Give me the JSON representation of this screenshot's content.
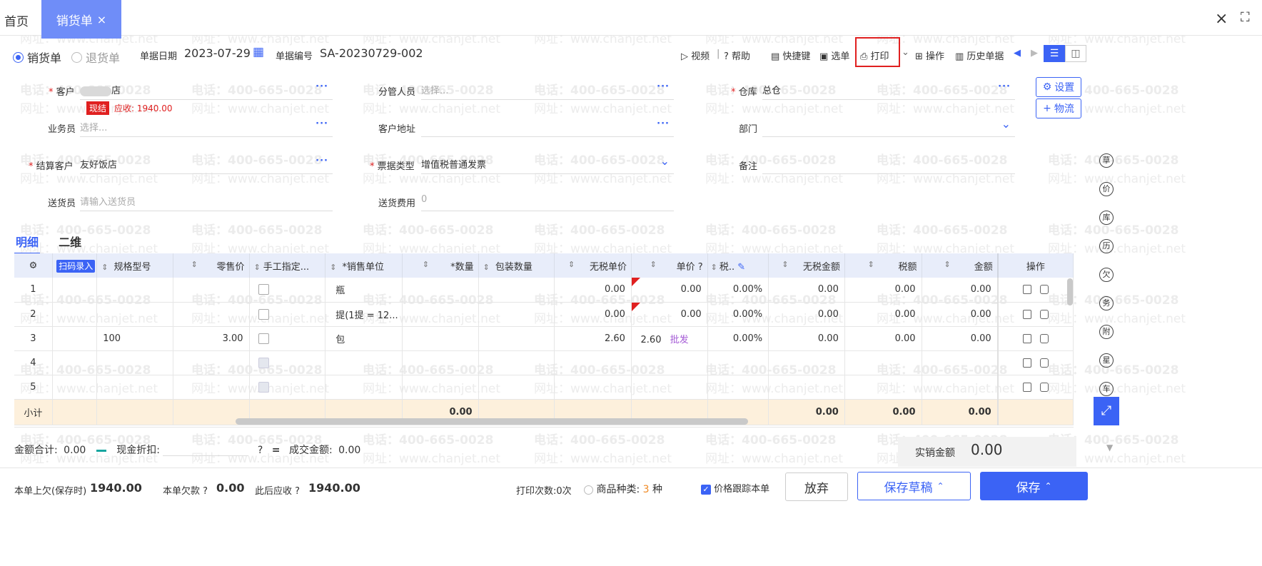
{
  "tabs": {
    "home": "首页",
    "active": "销货单"
  },
  "window": {
    "close_icon": "×",
    "full_icon": "⛶"
  },
  "watermark": {
    "phone": "电话：400-665-0028",
    "site": "网址：www.chanjet.net"
  },
  "toolbar": {
    "type_sales": "销货单",
    "type_return": "退货单",
    "date_label": "单据日期",
    "date_value": "2023-07-29",
    "no_label": "单据编号",
    "no_value": "SA-20230729-002",
    "video": "视频",
    "help": "帮助",
    "shortcut": "快捷键",
    "pick": "选单",
    "print": "打印",
    "ops": "操作",
    "history": "历史单据"
  },
  "form": {
    "customer_label": "客户",
    "customer_value": "店",
    "customer_badge": "现结",
    "receivable": "应收: 1940.00",
    "manager_label": "分管人员",
    "manager_ph": "选择...",
    "warehouse_label": "仓库",
    "warehouse_value": "总仓",
    "salesman_label": "业务员",
    "salesman_ph": "选择...",
    "address_label": "客户地址",
    "dept_label": "部门",
    "settle_label": "结算客户",
    "settle_value": "友好饭店",
    "invoice_label": "票据类型",
    "invoice_value": "增值税普通发票",
    "remark_label": "备注",
    "deliverer_label": "送货员",
    "deliverer_ph": "请输入送货员",
    "fee_label": "送货费用",
    "fee_ph": "0",
    "settings_btn": "设置",
    "logistics_btn": "物流"
  },
  "detail_tabs": [
    "明细",
    "二维"
  ],
  "table": {
    "headers": {
      "scan": "扫码录入",
      "spec": "规格型号",
      "retail": "零售价",
      "manual": "手工指定...",
      "unit": "*销售单位",
      "qty": "*数量",
      "pack": "包装数量",
      "notax_price": "无税单价",
      "price": "单价",
      "tax": "税..",
      "notax_amt": "无税金额",
      "tax_amt": "税额",
      "amount": "金额",
      "ops": "操作"
    },
    "rows": [
      {
        "no": "1",
        "spec": "",
        "retail": "",
        "unit": "瓶",
        "notax_price": "0.00",
        "price": "0.00",
        "tag": "",
        "tax": "0.00%",
        "notax_amt": "0.00",
        "tax_amt": "0.00",
        "amount": "0.00"
      },
      {
        "no": "2",
        "spec": "",
        "retail": "",
        "unit": "提(1提 = 12...",
        "notax_price": "0.00",
        "price": "0.00",
        "tag": "",
        "tax": "0.00%",
        "notax_amt": "0.00",
        "tax_amt": "0.00",
        "amount": "0.00"
      },
      {
        "no": "3",
        "spec": "100",
        "retail": "3.00",
        "unit": "包",
        "notax_price": "2.60",
        "price": "2.60",
        "tag": "批发",
        "tax": "0.00%",
        "notax_amt": "0.00",
        "tax_amt": "0.00",
        "amount": "0.00"
      },
      {
        "no": "4",
        "spec": "",
        "retail": "",
        "unit": "",
        "notax_price": "",
        "price": "",
        "tag": "",
        "tax": "",
        "notax_amt": "",
        "tax_amt": "",
        "amount": ""
      },
      {
        "no": "5",
        "spec": "",
        "retail": "",
        "unit": "",
        "notax_price": "",
        "price": "",
        "tag": "",
        "tax": "",
        "notax_amt": "",
        "tax_amt": "",
        "amount": ""
      }
    ],
    "subtotal": {
      "label": "小计",
      "qty": "0.00",
      "notax_amt": "0.00",
      "tax_amt": "0.00",
      "amount": "0.00"
    }
  },
  "totals": {
    "sum_label": "金额合计:",
    "sum_value": "0.00",
    "discount_label": "现金折扣:",
    "deal_label": "成交金额:",
    "deal_value": "0.00",
    "actual_label": "实销金额",
    "actual_value": "0.00"
  },
  "footer": {
    "prev_debt_label": "本单上欠(保存时)",
    "prev_debt_value": "1940.00",
    "this_debt_label": "本单欠款",
    "this_debt_value": "0.00",
    "after_label": "此后应收",
    "after_value": "1940.00",
    "print_count": "打印次数:0次",
    "kinds_label": "商品种类:",
    "kinds_value": "3",
    "kinds_unit": "种",
    "track_label": "价格跟踪本单",
    "discard": "放弃",
    "draft": "保存草稿",
    "save": "保存"
  },
  "dock": [
    "草",
    "价",
    "库",
    "历",
    "欠",
    "务",
    "附",
    "星",
    "车"
  ],
  "colors": {
    "accent": "#3b63f5",
    "tab": "#6f8df8",
    "danger": "#e02020",
    "subtotal": "#fdf0dc"
  }
}
